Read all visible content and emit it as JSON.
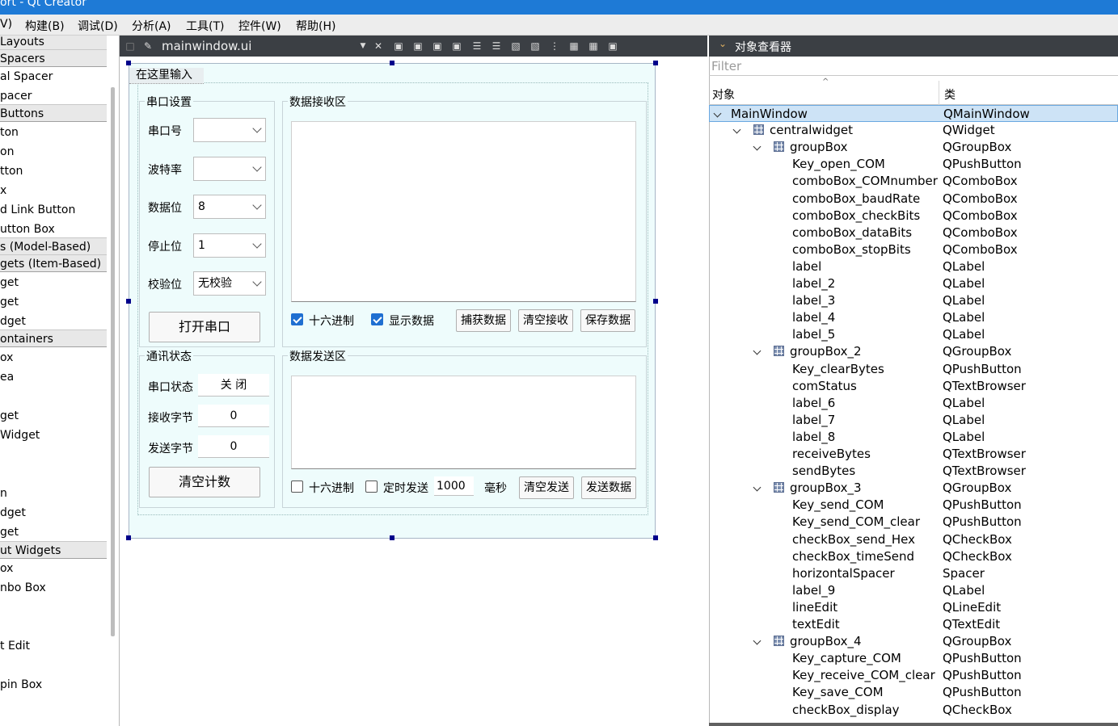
{
  "window": {
    "title": "ort - Qt Creator"
  },
  "menubar": [
    "V)",
    "构建(B)",
    "调试(D)",
    "分析(A)",
    "工具(T)",
    "控件(W)",
    "帮助(H)"
  ],
  "widgetbox": {
    "rows": [
      {
        "label": "Layouts",
        "cat": true
      },
      {
        "label": "Spacers",
        "cat": true
      },
      {
        "label": "al Spacer",
        "cat": false
      },
      {
        "label": "pacer",
        "cat": false
      },
      {
        "label": "Buttons",
        "cat": true
      },
      {
        "label": "ton",
        "cat": false
      },
      {
        "label": "on",
        "cat": false
      },
      {
        "label": "tton",
        "cat": false
      },
      {
        "label": "x",
        "cat": false
      },
      {
        "label": "d Link Button",
        "cat": false
      },
      {
        "label": "utton Box",
        "cat": false
      },
      {
        "label": "s (Model-Based)",
        "cat": true
      },
      {
        "label": "gets (Item-Based)",
        "cat": true
      },
      {
        "label": "get",
        "cat": false
      },
      {
        "label": "get",
        "cat": false
      },
      {
        "label": "dget",
        "cat": false
      },
      {
        "label": "ontainers",
        "cat": true
      },
      {
        "label": "ox",
        "cat": false
      },
      {
        "label": "ea",
        "cat": false
      },
      {
        "label": "",
        "cat": false
      },
      {
        "label": "get",
        "cat": false
      },
      {
        "label": "Widget",
        "cat": false
      },
      {
        "label": "",
        "cat": false
      },
      {
        "label": "",
        "cat": false
      },
      {
        "label": "n",
        "cat": false
      },
      {
        "label": "dget",
        "cat": false
      },
      {
        "label": "get",
        "cat": false
      },
      {
        "label": "ut Widgets",
        "cat": true
      },
      {
        "label": "ox",
        "cat": false
      },
      {
        "label": "nbo Box",
        "cat": false
      },
      {
        "label": "",
        "cat": false
      },
      {
        "label": "",
        "cat": false
      },
      {
        "label": "t Edit",
        "cat": false
      },
      {
        "label": "",
        "cat": false
      },
      {
        "label": "pin Box",
        "cat": false
      }
    ]
  },
  "editor": {
    "filename": "mainwindow.ui"
  },
  "form": {
    "menu_placeholder": "在这里输入",
    "serial_group": {
      "title": "串口设置",
      "fields": [
        {
          "label": "串口号",
          "value": ""
        },
        {
          "label": "波特率",
          "value": ""
        },
        {
          "label": "数据位",
          "value": "8"
        },
        {
          "label": "停止位",
          "value": "1"
        },
        {
          "label": "校验位",
          "value": "无校验"
        }
      ],
      "open_button": "打开串口"
    },
    "status_group": {
      "title": "通讯状态",
      "rows": [
        {
          "label": "串口状态",
          "value": "关 闭"
        },
        {
          "label": "接收字节",
          "value": "0"
        },
        {
          "label": "发送字节",
          "value": "0"
        }
      ],
      "clear_button": "清空计数"
    },
    "receive_group": {
      "title": "数据接收区",
      "hex_checkbox": "十六进制",
      "display_checkbox": "显示数据",
      "capture_button": "捕获数据",
      "clear_button": "清空接收",
      "save_button": "保存数据"
    },
    "send_group": {
      "title": "数据发送区",
      "hex_checkbox": "十六进制",
      "timer_checkbox": "定时发送",
      "interval": "1000",
      "unit": "毫秒",
      "clear_button": "清空发送",
      "send_button": "发送数据"
    }
  },
  "inspector": {
    "title": "对象查看器",
    "filter_placeholder": "Filter",
    "col_object": "对象",
    "col_class": "类",
    "rows": [
      {
        "obj": "MainWindow",
        "cls": "QMainWindow",
        "level": 0,
        "expand": true,
        "icon": false,
        "sel": true
      },
      {
        "obj": "centralwidget",
        "cls": "QWidget",
        "level": 1,
        "expand": true,
        "icon": true,
        "sel": false
      },
      {
        "obj": "groupBox",
        "cls": "QGroupBox",
        "level": 2,
        "expand": true,
        "icon": true,
        "sel": false
      },
      {
        "obj": "Key_open_COM",
        "cls": "QPushButton",
        "level": 3,
        "expand": false,
        "icon": false,
        "sel": false
      },
      {
        "obj": "comboBox_COMnumber",
        "cls": "QComboBox",
        "level": 3,
        "expand": false,
        "icon": false,
        "sel": false
      },
      {
        "obj": "comboBox_baudRate",
        "cls": "QComboBox",
        "level": 3,
        "expand": false,
        "icon": false,
        "sel": false
      },
      {
        "obj": "comboBox_checkBits",
        "cls": "QComboBox",
        "level": 3,
        "expand": false,
        "icon": false,
        "sel": false
      },
      {
        "obj": "comboBox_dataBits",
        "cls": "QComboBox",
        "level": 3,
        "expand": false,
        "icon": false,
        "sel": false
      },
      {
        "obj": "comboBox_stopBits",
        "cls": "QComboBox",
        "level": 3,
        "expand": false,
        "icon": false,
        "sel": false
      },
      {
        "obj": "label",
        "cls": "QLabel",
        "level": 3,
        "expand": false,
        "icon": false,
        "sel": false
      },
      {
        "obj": "label_2",
        "cls": "QLabel",
        "level": 3,
        "expand": false,
        "icon": false,
        "sel": false
      },
      {
        "obj": "label_3",
        "cls": "QLabel",
        "level": 3,
        "expand": false,
        "icon": false,
        "sel": false
      },
      {
        "obj": "label_4",
        "cls": "QLabel",
        "level": 3,
        "expand": false,
        "icon": false,
        "sel": false
      },
      {
        "obj": "label_5",
        "cls": "QLabel",
        "level": 3,
        "expand": false,
        "icon": false,
        "sel": false
      },
      {
        "obj": "groupBox_2",
        "cls": "QGroupBox",
        "level": 2,
        "expand": true,
        "icon": true,
        "sel": false
      },
      {
        "obj": "Key_clearBytes",
        "cls": "QPushButton",
        "level": 3,
        "expand": false,
        "icon": false,
        "sel": false
      },
      {
        "obj": "comStatus",
        "cls": "QTextBrowser",
        "level": 3,
        "expand": false,
        "icon": false,
        "sel": false
      },
      {
        "obj": "label_6",
        "cls": "QLabel",
        "level": 3,
        "expand": false,
        "icon": false,
        "sel": false
      },
      {
        "obj": "label_7",
        "cls": "QLabel",
        "level": 3,
        "expand": false,
        "icon": false,
        "sel": false
      },
      {
        "obj": "label_8",
        "cls": "QLabel",
        "level": 3,
        "expand": false,
        "icon": false,
        "sel": false
      },
      {
        "obj": "receiveBytes",
        "cls": "QTextBrowser",
        "level": 3,
        "expand": false,
        "icon": false,
        "sel": false
      },
      {
        "obj": "sendBytes",
        "cls": "QTextBrowser",
        "level": 3,
        "expand": false,
        "icon": false,
        "sel": false
      },
      {
        "obj": "groupBox_3",
        "cls": "QGroupBox",
        "level": 2,
        "expand": true,
        "icon": true,
        "sel": false
      },
      {
        "obj": "Key_send_COM",
        "cls": "QPushButton",
        "level": 3,
        "expand": false,
        "icon": false,
        "sel": false
      },
      {
        "obj": "Key_send_COM_clear",
        "cls": "QPushButton",
        "level": 3,
        "expand": false,
        "icon": false,
        "sel": false
      },
      {
        "obj": "checkBox_send_Hex",
        "cls": "QCheckBox",
        "level": 3,
        "expand": false,
        "icon": false,
        "sel": false
      },
      {
        "obj": "checkBox_timeSend",
        "cls": "QCheckBox",
        "level": 3,
        "expand": false,
        "icon": false,
        "sel": false
      },
      {
        "obj": "horizontalSpacer",
        "cls": "Spacer",
        "level": 3,
        "expand": false,
        "icon": false,
        "sel": false
      },
      {
        "obj": "label_9",
        "cls": "QLabel",
        "level": 3,
        "expand": false,
        "icon": false,
        "sel": false
      },
      {
        "obj": "lineEdit",
        "cls": "QLineEdit",
        "level": 3,
        "expand": false,
        "icon": false,
        "sel": false
      },
      {
        "obj": "textEdit",
        "cls": "QTextEdit",
        "level": 3,
        "expand": false,
        "icon": false,
        "sel": false
      },
      {
        "obj": "groupBox_4",
        "cls": "QGroupBox",
        "level": 2,
        "expand": true,
        "icon": true,
        "sel": false
      },
      {
        "obj": "Key_capture_COM",
        "cls": "QPushButton",
        "level": 3,
        "expand": false,
        "icon": false,
        "sel": false
      },
      {
        "obj": "Key_receive_COM_clear",
        "cls": "QPushButton",
        "level": 3,
        "expand": false,
        "icon": false,
        "sel": false
      },
      {
        "obj": "Key_save_COM",
        "cls": "QPushButton",
        "level": 3,
        "expand": false,
        "icon": false,
        "sel": false
      },
      {
        "obj": "checkBox_display",
        "cls": "QCheckBox",
        "level": 3,
        "expand": false,
        "icon": false,
        "sel": false
      }
    ]
  }
}
